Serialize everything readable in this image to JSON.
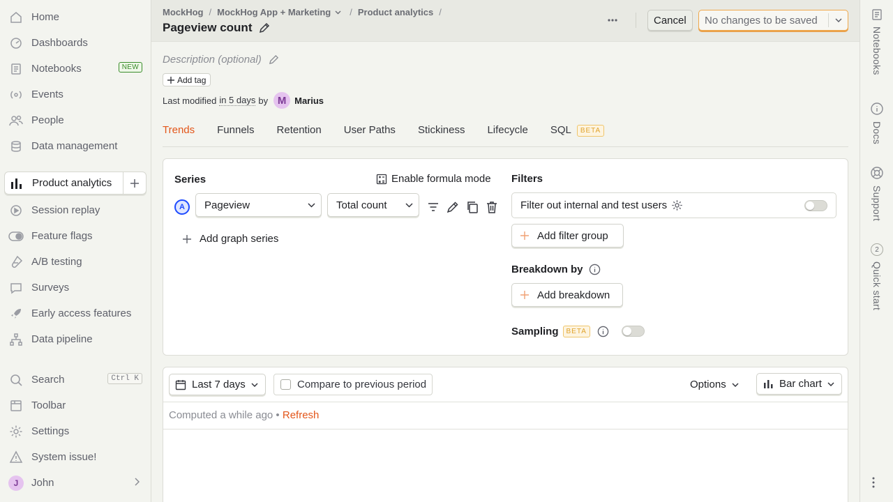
{
  "sidebar": {
    "items": [
      {
        "label": "Home",
        "icon": "home-icon"
      },
      {
        "label": "Dashboards",
        "icon": "dashboard-icon"
      },
      {
        "label": "Notebooks",
        "icon": "notebook-icon",
        "badge": "NEW"
      },
      {
        "label": "Events",
        "icon": "events-icon"
      },
      {
        "label": "People",
        "icon": "people-icon"
      },
      {
        "label": "Data management",
        "icon": "database-icon"
      }
    ],
    "active": {
      "label": "Product analytics",
      "icon": "bar-chart-icon"
    },
    "items2": [
      {
        "label": "Session replay",
        "icon": "replay-icon"
      },
      {
        "label": "Feature flags",
        "icon": "toggle-icon"
      },
      {
        "label": "A/B testing",
        "icon": "flask-icon"
      },
      {
        "label": "Surveys",
        "icon": "survey-icon"
      },
      {
        "label": "Early access features",
        "icon": "rocket-icon"
      },
      {
        "label": "Data pipeline",
        "icon": "pipeline-icon"
      }
    ],
    "bottom": [
      {
        "label": "Search",
        "icon": "search-icon",
        "shortcut": "Ctrl K"
      },
      {
        "label": "Toolbar",
        "icon": "toolbar-icon"
      },
      {
        "label": "Settings",
        "icon": "gear-icon"
      },
      {
        "label": "System issue!",
        "icon": "warning-icon"
      }
    ],
    "user": {
      "initial": "J",
      "name": "John"
    }
  },
  "header": {
    "breadcrumbs": [
      "MockHog",
      "MockHog App + Marketing",
      "Product analytics"
    ],
    "title": "Pageview count",
    "cancel_label": "Cancel",
    "save_label": "No changes to be saved"
  },
  "right_rail": [
    "Notebooks",
    "Docs",
    "Support",
    "Quick start"
  ],
  "right_rail_badge": "2",
  "insight": {
    "description_placeholder": "Description (optional)",
    "add_tag": "Add tag",
    "modified_prefix": "Last modified",
    "modified_time": "in 5 days",
    "modified_by": "by",
    "author_initial": "M",
    "author": "Marius"
  },
  "tabs": [
    {
      "label": "Trends",
      "active": true
    },
    {
      "label": "Funnels"
    },
    {
      "label": "Retention"
    },
    {
      "label": "User Paths"
    },
    {
      "label": "Stickiness"
    },
    {
      "label": "Lifecycle"
    },
    {
      "label": "SQL",
      "badge": "BETA"
    }
  ],
  "query": {
    "series_title": "Series",
    "formula_label": "Enable formula mode",
    "series_letter": "A",
    "event": "Pageview",
    "math": "Total count",
    "add_series": "Add graph series",
    "filters_title": "Filters",
    "internal_filter": "Filter out internal and test users",
    "add_filter_group": "Add filter group",
    "breakdown_title": "Breakdown by",
    "add_breakdown": "Add breakdown",
    "sampling_title": "Sampling",
    "sampling_badge": "BETA"
  },
  "results": {
    "date_range": "Last 7 days",
    "compare_label": "Compare to previous period",
    "options_label": "Options",
    "chart_type": "Bar chart",
    "computed_text": "Computed a while ago •",
    "refresh_label": "Refresh"
  },
  "colors": {
    "accent": "#e3561a",
    "primary": "#1d4aff",
    "save_border": "#f0a84b"
  }
}
